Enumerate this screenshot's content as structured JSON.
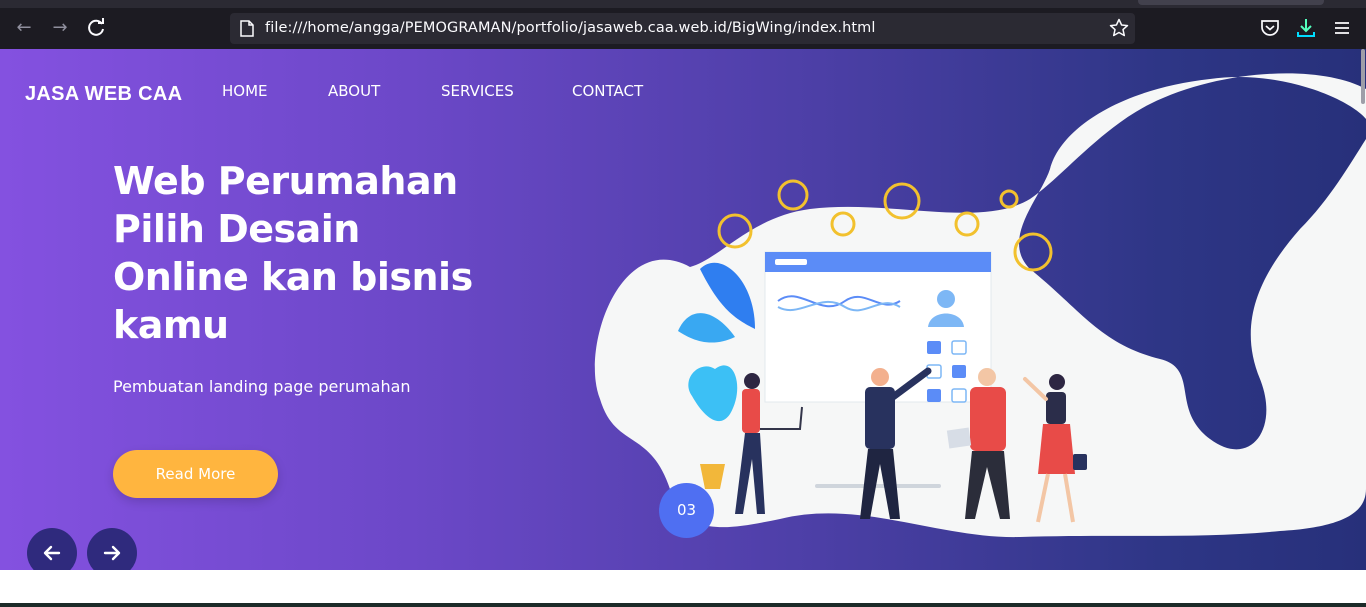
{
  "browser": {
    "url": "file:///home/angga/PEMOGRAMAN/portfolio/jasaweb.caa.web.id/BigWing/index.html",
    "icons": [
      "back-icon",
      "forward-icon",
      "reload-icon",
      "page-icon",
      "bookmark-star-icon",
      "pocket-icon",
      "download-icon",
      "menu-icon"
    ]
  },
  "site": {
    "brand": "JASA WEB CAA",
    "nav": [
      "HOME",
      "ABOUT",
      "SERVICES",
      "CONTACT"
    ]
  },
  "hero": {
    "headline_lines": [
      "Web Perumahan",
      "Pilih Desain",
      "Online kan bisnis",
      "kamu"
    ],
    "subtitle": "Pembuatan landing page perumahan",
    "cta": "Read More",
    "slide_number": "03"
  },
  "colors": {
    "gradient_start": "#8451e0",
    "gradient_end": "#27307a",
    "cta": "#ffb53f",
    "slide_badge": "#4f6ff2",
    "arrow_button": "#2f2a7d"
  }
}
